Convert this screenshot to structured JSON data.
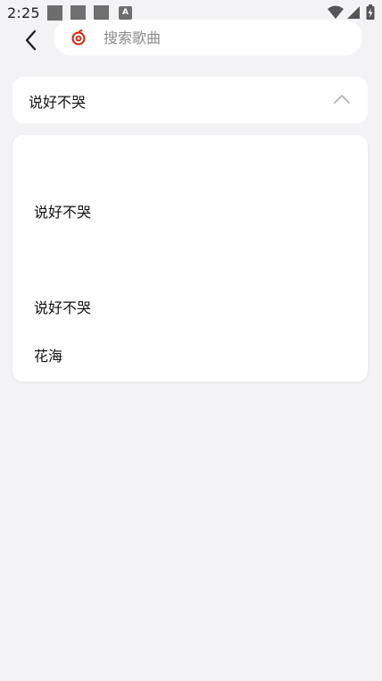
{
  "status_bar": {
    "time": "2:25",
    "notification_icons": [
      "notification-icon",
      "notification-icon",
      "notification-icon",
      "accessibility-icon"
    ],
    "right_icons": [
      "wifi-icon",
      "signal-icon",
      "battery-charging-icon"
    ],
    "accessibility_glyph": "A"
  },
  "search": {
    "placeholder": "搜索歌曲",
    "value": "",
    "logo_icon": "netease-music-icon",
    "logo_color": "#d81e06"
  },
  "select": {
    "selected_value": "说好不哭",
    "chevron_icon": "chevron-up-icon"
  },
  "dropdown": {
    "options": [
      {
        "label": ""
      },
      {
        "label": "说好不哭"
      },
      {
        "label": ""
      },
      {
        "label": "说好不哭"
      },
      {
        "label": "花海"
      }
    ]
  },
  "colors": {
    "background": "#f3f3f5",
    "card": "#ffffff",
    "text": "#111111",
    "placeholder": "#8a8a8a",
    "brand_red": "#d81e06"
  }
}
